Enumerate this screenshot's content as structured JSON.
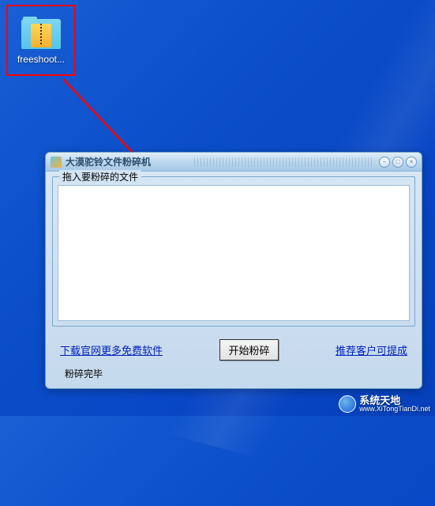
{
  "desktop": {
    "icon_label": "freeshoot..."
  },
  "window": {
    "title": "大漠驼铃文件粉碎机",
    "groupbox_label": "拖入要粉碎的文件",
    "link_download": "下载官网更多免费软件",
    "btn_shred": "开始粉碎",
    "link_recommend": "推荐客户可提成",
    "status": "粉碎完毕",
    "controls": {
      "min": "−",
      "max": "□",
      "close": "×"
    }
  },
  "watermark": {
    "main": "系统天地",
    "sub": "www.XiTongTianDi.net"
  }
}
